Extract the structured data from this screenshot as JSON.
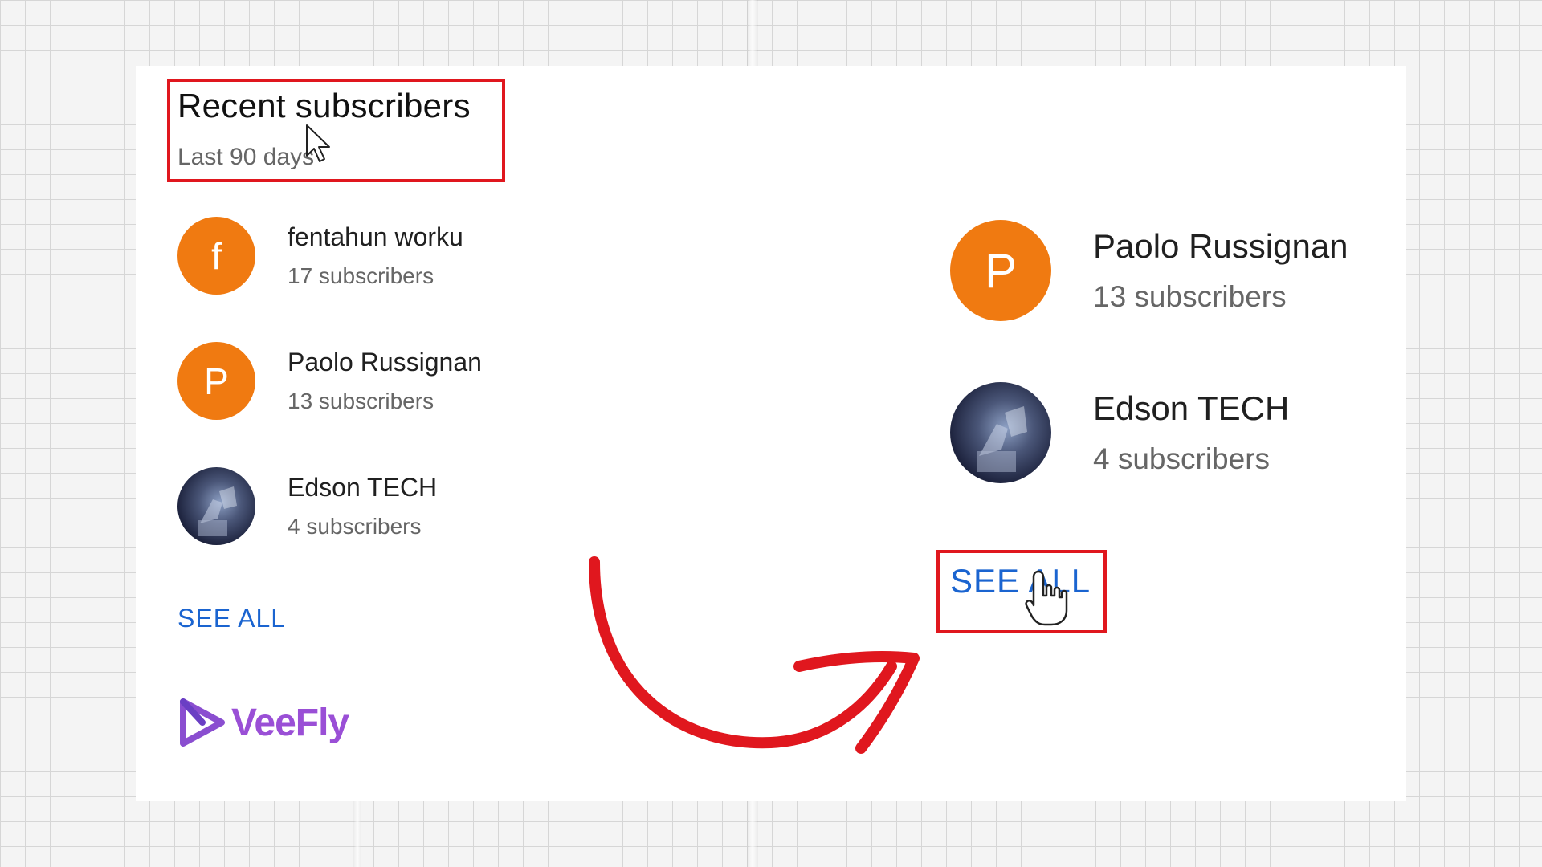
{
  "header": {
    "title": "Recent subscribers",
    "subtitle": "Last 90 days"
  },
  "subscribers": [
    {
      "initial": "f",
      "name": "fentahun worku",
      "count": "17 subscribers",
      "avatar_color": "#f07a11"
    },
    {
      "initial": "P",
      "name": "Paolo Russignan",
      "count": "13 subscribers",
      "avatar_color": "#f07a11"
    },
    {
      "initial": "",
      "name": "Edson TECH",
      "count": "4 subscribers",
      "avatar_color": "#2a3150"
    }
  ],
  "zoomed_subscribers": [
    {
      "initial": "P",
      "name": "Paolo Russignan",
      "count": "13 subscribers"
    },
    {
      "initial": "",
      "name": "Edson TECH",
      "count": "4 subscribers"
    }
  ],
  "see_all_label": "SEE ALL",
  "zoomed_see_all_label": "SEE ALL",
  "logo": {
    "text": "VeeFly",
    "icon": "veefly-play-icon"
  },
  "colors": {
    "highlight": "#e0171e",
    "link": "#1a64d0",
    "avatar_orange": "#f07a11",
    "logo_purple": "#9a4fd6"
  }
}
